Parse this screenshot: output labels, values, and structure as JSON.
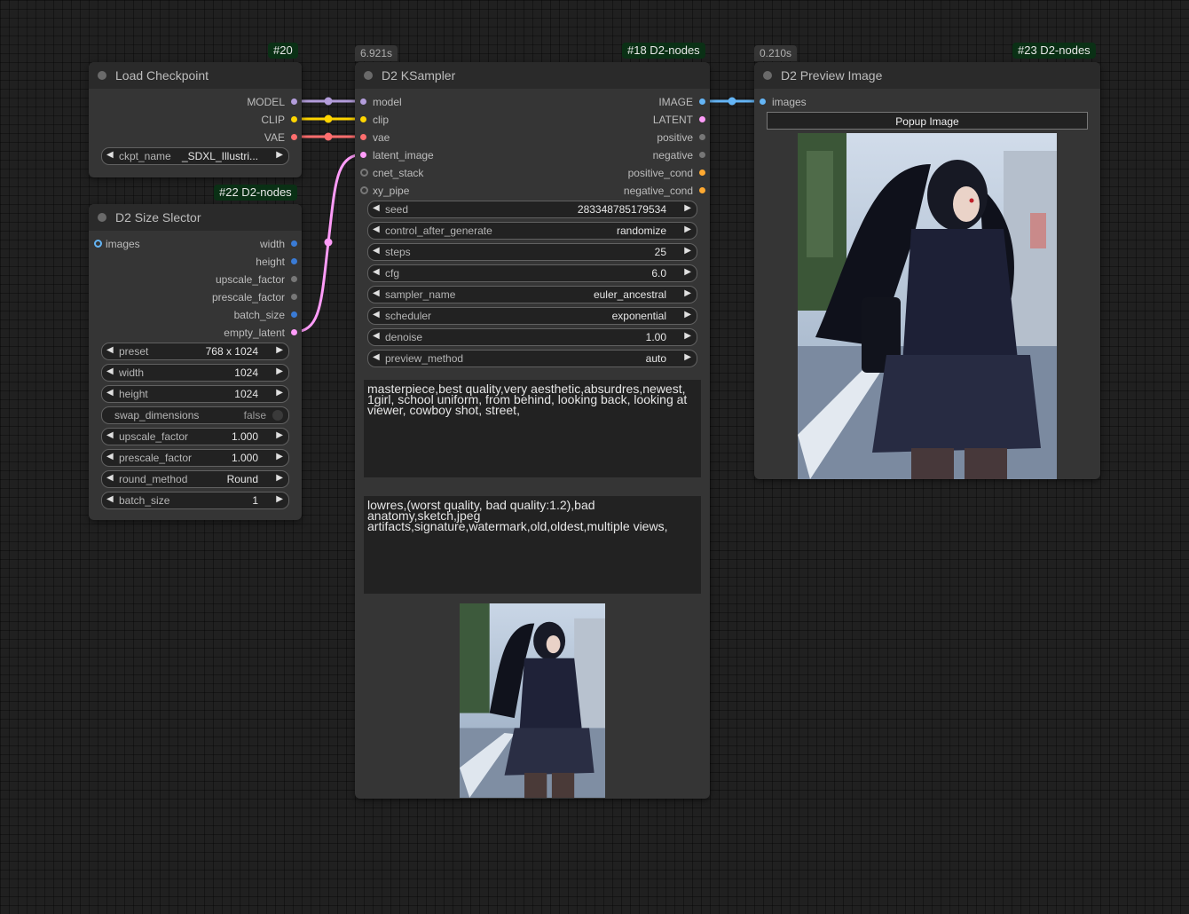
{
  "colors": {
    "model": "#b39ddb",
    "clip": "#ffd500",
    "vae": "#ff6e6e",
    "latent": "#ff9cf9",
    "image": "#64b5f6",
    "int": "#3a7bd5",
    "float": "#777777",
    "conditioning": "#ffa931",
    "badge_bg": "#0a3015"
  },
  "load_checkpoint": {
    "badge": "#20",
    "title": "Load Checkpoint",
    "outputs": [
      "MODEL",
      "CLIP",
      "VAE"
    ],
    "widget": {
      "label": "ckpt_name",
      "value": "_SDXL_Illustri..."
    }
  },
  "size_selector": {
    "badge": "#22 D2-nodes",
    "title": "D2 Size Slector",
    "input": "images",
    "outputs": [
      "width",
      "height",
      "upscale_factor",
      "prescale_factor",
      "batch_size",
      "empty_latent"
    ],
    "widgets": [
      {
        "label": "preset",
        "value": "768 x 1024"
      },
      {
        "label": "width",
        "value": "1024"
      },
      {
        "label": "height",
        "value": "1024"
      }
    ],
    "toggle": {
      "label": "swap_dimensions",
      "value": "false"
    },
    "widgets2": [
      {
        "label": "upscale_factor",
        "value": "1.000"
      },
      {
        "label": "prescale_factor",
        "value": "1.000"
      },
      {
        "label": "round_method",
        "value": "Round"
      },
      {
        "label": "batch_size",
        "value": "1"
      }
    ]
  },
  "ksampler": {
    "timing": "6.921s",
    "badge": "#18 D2-nodes",
    "title": "D2 KSampler",
    "inputs": [
      "model",
      "clip",
      "vae",
      "latent_image",
      "cnet_stack",
      "xy_pipe"
    ],
    "outputs": [
      "IMAGE",
      "LATENT",
      "positive",
      "negative",
      "positive_cond",
      "negative_cond"
    ],
    "widgets": [
      {
        "label": "seed",
        "value": "283348785179534"
      },
      {
        "label": "control_after_generate",
        "value": "randomize"
      },
      {
        "label": "steps",
        "value": "25"
      },
      {
        "label": "cfg",
        "value": "6.0"
      },
      {
        "label": "sampler_name",
        "value": "euler_ancestral"
      },
      {
        "label": "scheduler",
        "value": "exponential"
      },
      {
        "label": "denoise",
        "value": "1.00"
      },
      {
        "label": "preview_method",
        "value": "auto"
      }
    ],
    "positive_prompt": "masterpiece,best quality,very aesthetic,absurdres,newest,\n1girl, school uniform, from behind, looking back, looking at viewer, cowboy shot, street,",
    "negative_prompt": "lowres,(worst quality, bad quality:1.2),bad anatomy,sketch,jpeg artifacts,signature,watermark,old,oldest,multiple views,"
  },
  "preview": {
    "timing": "0.210s",
    "badge": "#23 D2-nodes",
    "title": "D2 Preview Image",
    "input": "images",
    "button": "Popup Image"
  }
}
